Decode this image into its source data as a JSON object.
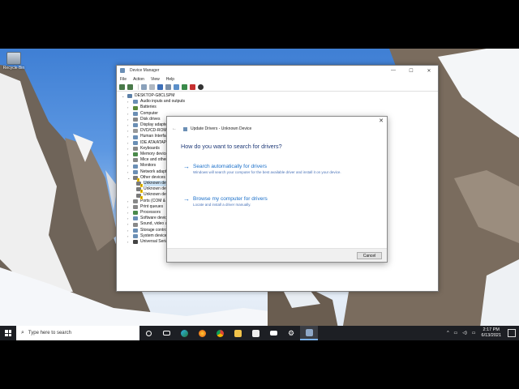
{
  "desktop": {
    "recycle_bin_label": "Recycle Bin"
  },
  "device_manager": {
    "title": "Device Manager",
    "window_controls": [
      "—",
      "☐",
      "✕"
    ],
    "menu": [
      "File",
      "Action",
      "View",
      "Help"
    ],
    "root": "DESKTOP-G8CLSPM",
    "tree": [
      "Audio inputs and outputs",
      "Batteries",
      "Computer",
      "Disk drives",
      "Display adapters",
      "DVD/CD-ROM drives",
      "Human Interface Devices",
      "IDE ATA/ATAPI controllers",
      "Keyboards",
      "Memory devices",
      "Mice and other pointing devices",
      "Monitors",
      "Network adapters",
      "Other devices"
    ],
    "other_devices": [
      "Unknown device",
      "Unknown device",
      "Unknown device"
    ],
    "tree_after": [
      "Ports (COM & LPT)",
      "Print queues",
      "Processors",
      "Software devices",
      "Sound, video and game controllers",
      "Storage controllers",
      "System devices",
      "Universal Serial Bus controllers"
    ]
  },
  "dialog": {
    "close": "✕",
    "header": "Update Drivers - Unknown Device",
    "question": "How do you want to search for drivers?",
    "option1_title": "Search automatically for drivers",
    "option1_desc": "Windows will search your computer for the best available driver and install it on your device.",
    "option2_title": "Browse my computer for drivers",
    "option2_desc": "Locate and install a driver manually.",
    "cancel_label": "Cancel"
  },
  "taskbar": {
    "search_placeholder": "Type here to search",
    "time": "2:17 PM",
    "date": "6/13/2021",
    "icons": [
      "cortana-icon",
      "task-view-icon",
      "edge-icon",
      "firefox-icon",
      "chrome-icon",
      "file-explorer-icon",
      "store-icon",
      "mail-icon",
      "settings-icon",
      "device-manager-icon"
    ]
  },
  "colors": {
    "accent": "#1a6fc9",
    "question": "#1f3a78",
    "taskbar": "#1d1f24"
  }
}
